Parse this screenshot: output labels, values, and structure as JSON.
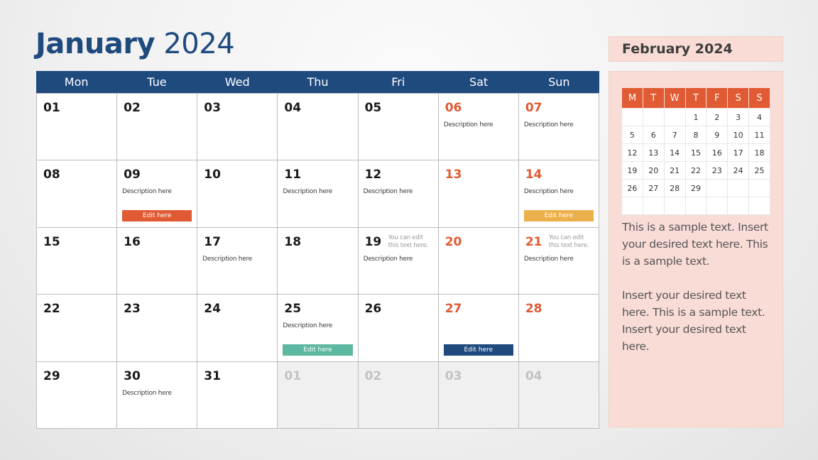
{
  "title": {
    "month": "January",
    "year": "2024"
  },
  "colors": {
    "primary": "#1f4a7e",
    "accent": "#e05a33",
    "panel": "#f9dcd6",
    "edit_orange": "#e05a33",
    "edit_yellow": "#ebb04a",
    "edit_teal": "#5cb8a0",
    "edit_navy": "#1f4a7e"
  },
  "weekdays": [
    "Mon",
    "Tue",
    "Wed",
    "Thu",
    "Fri",
    "Sat",
    "Sun"
  ],
  "days": [
    {
      "num": "01"
    },
    {
      "num": "02"
    },
    {
      "num": "03"
    },
    {
      "num": "04"
    },
    {
      "num": "05"
    },
    {
      "num": "06",
      "weekend": true,
      "desc": "Description here"
    },
    {
      "num": "07",
      "weekend": true,
      "desc": "Description here"
    },
    {
      "num": "08"
    },
    {
      "num": "09",
      "desc": "Description here",
      "edit": "Edit here",
      "edit_color": "#e05a33"
    },
    {
      "num": "10"
    },
    {
      "num": "11",
      "desc": "Description here"
    },
    {
      "num": "12",
      "desc": "Description here"
    },
    {
      "num": "13",
      "weekend": true
    },
    {
      "num": "14",
      "weekend": true,
      "desc": "Description here",
      "edit": "Edit here",
      "edit_color": "#ebb04a"
    },
    {
      "num": "15"
    },
    {
      "num": "16"
    },
    {
      "num": "17",
      "desc": "Description here"
    },
    {
      "num": "18"
    },
    {
      "num": "19",
      "desc": "Description here",
      "note": "You can edit this text here."
    },
    {
      "num": "20",
      "weekend": true
    },
    {
      "num": "21",
      "weekend": true,
      "desc": "Description here",
      "note": "You can edit this text here."
    },
    {
      "num": "22"
    },
    {
      "num": "23"
    },
    {
      "num": "24"
    },
    {
      "num": "25",
      "desc": "Description here",
      "edit": "Edit here",
      "edit_color": "#5cb8a0"
    },
    {
      "num": "26"
    },
    {
      "num": "27",
      "weekend": true,
      "edit": "Edit here",
      "edit_color": "#1f4a7e"
    },
    {
      "num": "28",
      "weekend": true
    },
    {
      "num": "29"
    },
    {
      "num": "30",
      "desc": "Description here"
    },
    {
      "num": "31"
    },
    {
      "num": "01",
      "other": true
    },
    {
      "num": "02",
      "other": true
    },
    {
      "num": "03",
      "other": true
    },
    {
      "num": "04",
      "other": true
    }
  ],
  "sidebar": {
    "title": "February 2024",
    "mini_headers": [
      "M",
      "T",
      "W",
      "T",
      "F",
      "S",
      "S"
    ],
    "mini_rows": [
      [
        "",
        "",
        "",
        "1",
        "2",
        "3",
        "4"
      ],
      [
        "5",
        "6",
        "7",
        "8",
        "9",
        "10",
        "11"
      ],
      [
        "12",
        "13",
        "14",
        "15",
        "16",
        "17",
        "18"
      ],
      [
        "19",
        "20",
        "21",
        "22",
        "23",
        "24",
        "25"
      ],
      [
        "26",
        "27",
        "28",
        "29",
        "",
        "",
        ""
      ],
      [
        "",
        "",
        "",
        "",
        "",
        "",
        ""
      ]
    ],
    "paragraphs": [
      "This is a sample text. Insert your desired text here. This is a sample text.",
      "Insert your desired text here. This is a sample text. Insert your desired text here."
    ]
  }
}
